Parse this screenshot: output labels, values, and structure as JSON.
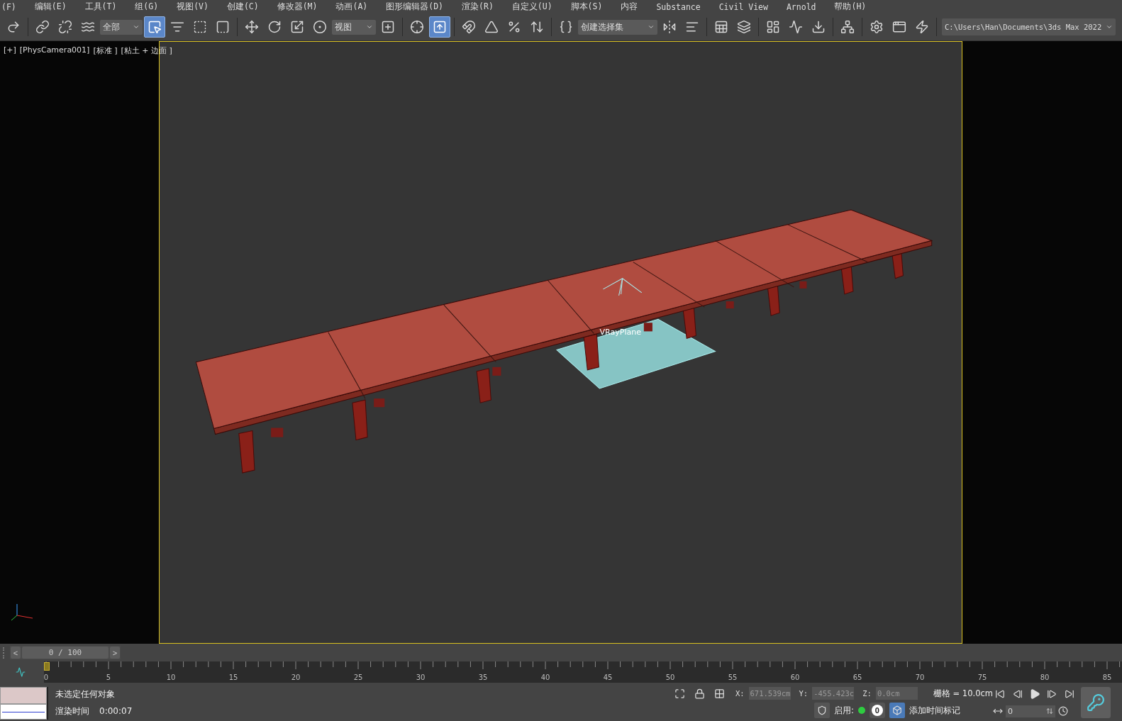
{
  "menu": [
    {
      "label": "(F)"
    },
    {
      "label": "编辑(E)"
    },
    {
      "label": "工具(T)"
    },
    {
      "label": "组(G)"
    },
    {
      "label": "视图(V)"
    },
    {
      "label": "创建(C)"
    },
    {
      "label": "修改器(M)"
    },
    {
      "label": "动画(A)"
    },
    {
      "label": "图形编辑器(D)"
    },
    {
      "label": "渲染(R)"
    },
    {
      "label": "自定义(U)"
    },
    {
      "label": "脚本(S)"
    },
    {
      "label": "内容"
    },
    {
      "label": "Substance"
    },
    {
      "label": "Civil View"
    },
    {
      "label": "Arnold"
    },
    {
      "label": "帮助(H)"
    }
  ],
  "toolbar": [
    {
      "kind": "button",
      "selected": false
    },
    {
      "kind": "separator"
    },
    {
      "kind": "button",
      "selected": false
    },
    {
      "kind": "button",
      "selected": false
    },
    {
      "kind": "button",
      "selected": false
    },
    {
      "kind": "dropdown",
      "value": "全部"
    },
    {
      "kind": "button",
      "selected": true
    },
    {
      "kind": "button",
      "selected": false
    },
    {
      "kind": "button",
      "selected": false
    },
    {
      "kind": "button",
      "selected": false
    },
    {
      "kind": "separator"
    },
    {
      "kind": "button",
      "selected": false
    },
    {
      "kind": "button",
      "selected": false
    },
    {
      "kind": "button",
      "selected": false
    },
    {
      "kind": "button",
      "selected": false
    },
    {
      "kind": "dropdown",
      "value": "视图"
    },
    {
      "kind": "button",
      "selected": false
    },
    {
      "kind": "separator"
    },
    {
      "kind": "button",
      "selected": false
    },
    {
      "kind": "button",
      "selected": true
    },
    {
      "kind": "separator"
    },
    {
      "kind": "button",
      "selected": false
    },
    {
      "kind": "button",
      "selected": false
    },
    {
      "kind": "button",
      "selected": false
    },
    {
      "kind": "button",
      "selected": false
    },
    {
      "kind": "separator"
    },
    {
      "kind": "button",
      "selected": false
    },
    {
      "kind": "dropdown",
      "value": "创建选择集"
    },
    {
      "kind": "button",
      "selected": false
    },
    {
      "kind": "button",
      "selected": false
    },
    {
      "kind": "separator"
    },
    {
      "kind": "button",
      "selected": false
    },
    {
      "kind": "button",
      "selected": false
    },
    {
      "kind": "separator"
    },
    {
      "kind": "button",
      "selected": false
    },
    {
      "kind": "button",
      "selected": false
    },
    {
      "kind": "button",
      "selected": false
    },
    {
      "kind": "separator"
    },
    {
      "kind": "button",
      "selected": false
    },
    {
      "kind": "separator"
    },
    {
      "kind": "button",
      "selected": false
    },
    {
      "kind": "button",
      "selected": false
    },
    {
      "kind": "button",
      "selected": false
    },
    {
      "kind": "separator"
    },
    {
      "kind": "path",
      "value": "C:\\Users\\Han\\Documents\\3ds Max 2022"
    }
  ],
  "viewport": {
    "labels": [
      "[+]",
      "[PhysCamera001]",
      "[标准 ]",
      "[粘土 + 边面 ]"
    ],
    "object_label": "VRayPlane"
  },
  "timeline": {
    "frame_display": "0 / 100",
    "level": 0,
    "prev": "<",
    "next": ">",
    "ticks": [
      "0",
      "5",
      "10",
      "15",
      "20",
      "25",
      "30",
      "35",
      "40",
      "45",
      "50",
      "55",
      "60",
      "65",
      "70",
      "75",
      "80",
      "85"
    ]
  },
  "status": {
    "message": "未选定任何对象",
    "render_time_label": "渲染时间",
    "render_time": "0:00:07",
    "coords": [
      {
        "axis": "X:",
        "value": "671.539cm"
      },
      {
        "axis": "Y:",
        "value": "-455.423c"
      },
      {
        "axis": "Z:",
        "value": "0.0cm"
      }
    ],
    "grid": "栅格 = 10.0cm",
    "enable_label": "启用:",
    "enable_count": "0",
    "add_time_tag": "添加时间标记",
    "frame": "0"
  }
}
